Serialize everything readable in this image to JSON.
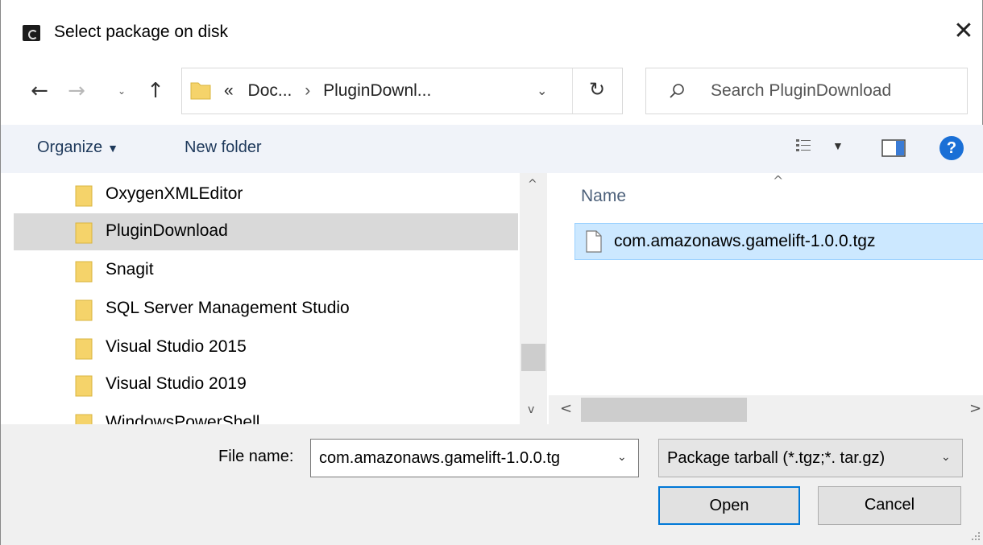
{
  "window": {
    "title": "Select package on disk",
    "close_glyph": "✕"
  },
  "nav": {
    "back_glyph": "←",
    "forward_glyph": "→",
    "recent_glyph": "⌄",
    "up_glyph": "↑",
    "breadcrumb_overflow": "«",
    "breadcrumb": [
      "Doc...",
      "PluginDownl..."
    ],
    "breadcrumb_sep": "›",
    "dropdown_glyph": "⌄",
    "refresh_glyph": "↻"
  },
  "search": {
    "placeholder": "Search PluginDownload"
  },
  "toolbar": {
    "organize_label": "Organize",
    "new_folder_label": "New folder",
    "caret_glyph": "▼",
    "help_label": "?"
  },
  "tree": {
    "items": [
      {
        "label": "OxygenXMLEditor",
        "selected": false
      },
      {
        "label": "PluginDownload",
        "selected": true
      },
      {
        "label": "Snagit",
        "selected": false
      },
      {
        "label": "SQL Server Management Studio",
        "selected": false
      },
      {
        "label": "Visual Studio 2015",
        "selected": false
      },
      {
        "label": "Visual Studio 2019",
        "selected": false
      },
      {
        "label": "WindowsPowerShell",
        "selected": false
      }
    ]
  },
  "content": {
    "column_name": "Name",
    "sort_glyph": "^",
    "files": [
      {
        "name": "com.amazonaws.gamelift-1.0.0.tgz",
        "selected": true
      }
    ]
  },
  "scrollbars": {
    "up_glyph": "^",
    "down_glyph": "v",
    "left_glyph": "<",
    "right_glyph": ">"
  },
  "bottom": {
    "file_name_label": "File name:",
    "file_name_value": "com.amazonaws.gamelift-1.0.0.tg",
    "file_type_value": "Package tarball (*.tgz;*. tar.gz)",
    "dropdown_glyph": "⌄",
    "open_label": "Open",
    "cancel_label": "Cancel"
  },
  "colors": {
    "accent": "#0078d7",
    "selection_bg": "#cce8ff",
    "folder": "#f5d36a"
  }
}
